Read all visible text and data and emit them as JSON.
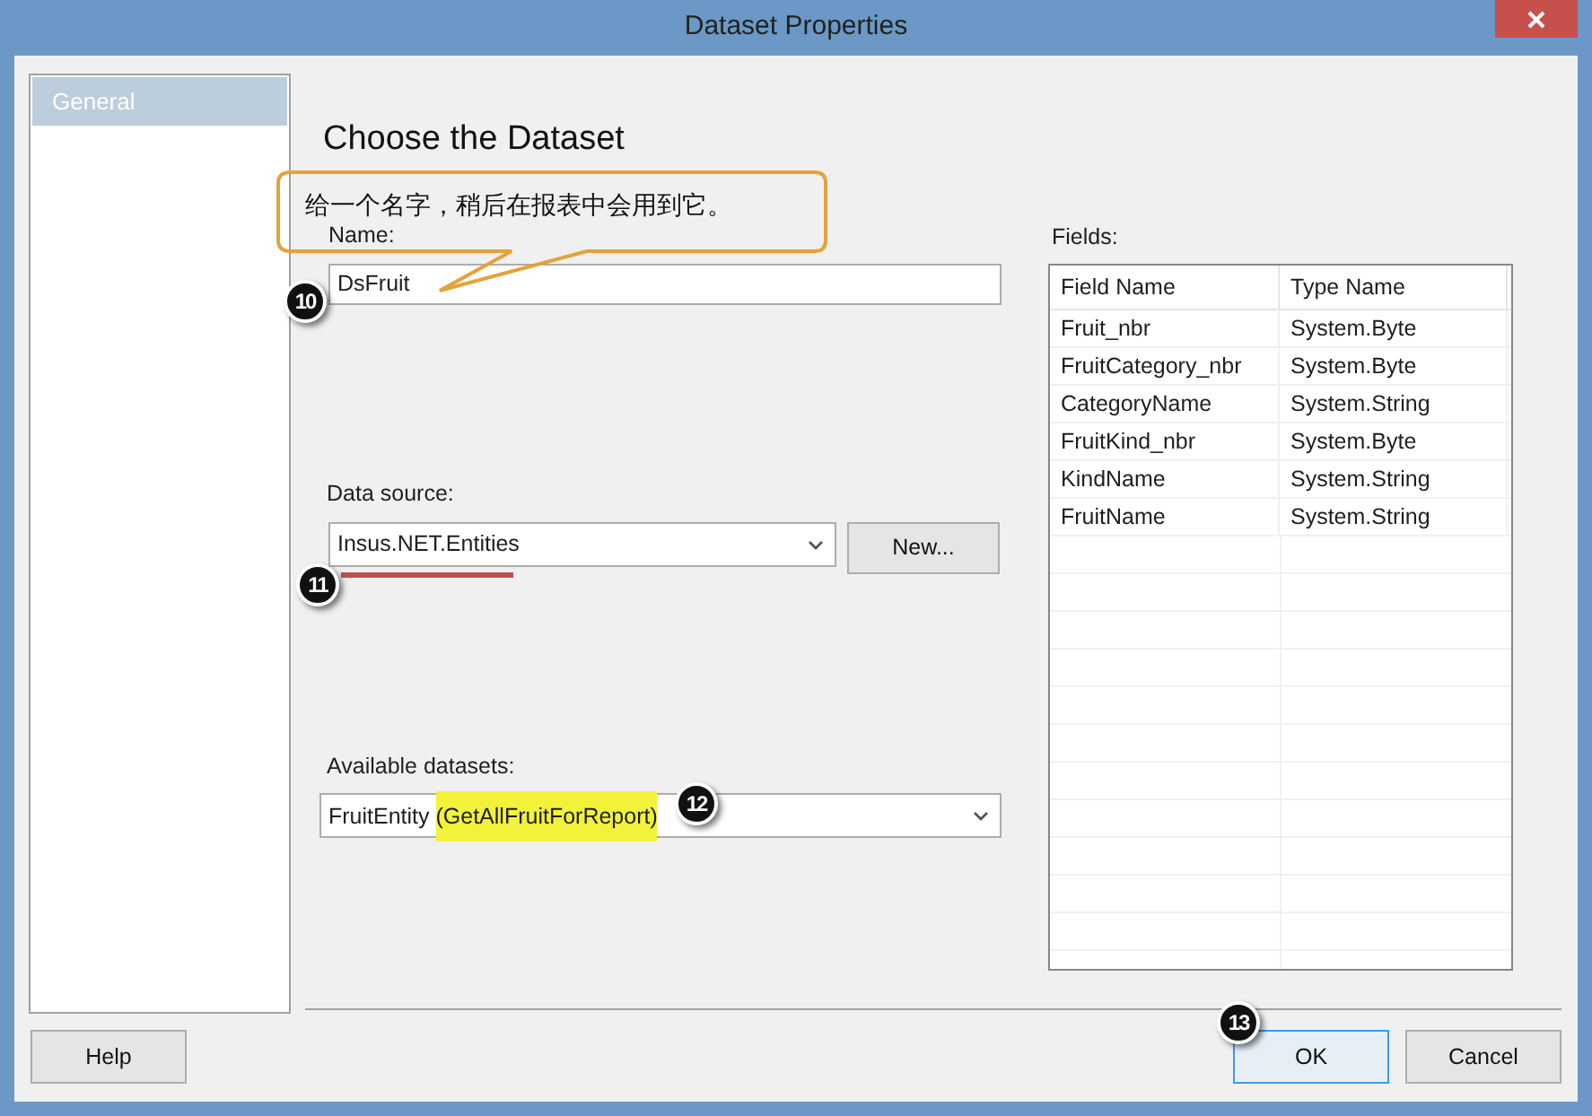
{
  "window": {
    "title": "Dataset Properties"
  },
  "sidebar": {
    "items": [
      {
        "label": "General",
        "selected": true
      }
    ]
  },
  "heading": "Choose the Dataset",
  "name_field": {
    "label": "Name:",
    "value": "DsFruit"
  },
  "data_source": {
    "label": "Data source:",
    "value": "Insus.NET.Entities",
    "underlined": true
  },
  "new_button": "New...",
  "available_datasets": {
    "label": "Available datasets:",
    "value": "FruitEntity",
    "detail": "(GetAllFruitForReport)",
    "detail_highlighted": true
  },
  "fields": {
    "label": "Fields:",
    "columns": [
      "Field Name",
      "Type Name"
    ],
    "rows": [
      [
        "Fruit_nbr",
        "System.Byte"
      ],
      [
        "FruitCategory_nbr",
        "System.Byte"
      ],
      [
        "CategoryName",
        "System.String"
      ],
      [
        "FruitKind_nbr",
        "System.Byte"
      ],
      [
        "KindName",
        "System.String"
      ],
      [
        "FruitName",
        "System.String"
      ]
    ]
  },
  "buttons": [
    {
      "label": "Help",
      "kind": "help",
      "default": false
    },
    {
      "label": "OK",
      "kind": "ok",
      "default": true
    },
    {
      "label": "Cancel",
      "kind": "cancel",
      "default": false
    }
  ],
  "annotations": {
    "callout": "给一个名字，稍后在报表中会用到它。",
    "markers": [
      "10",
      "11",
      "12",
      "13"
    ]
  }
}
